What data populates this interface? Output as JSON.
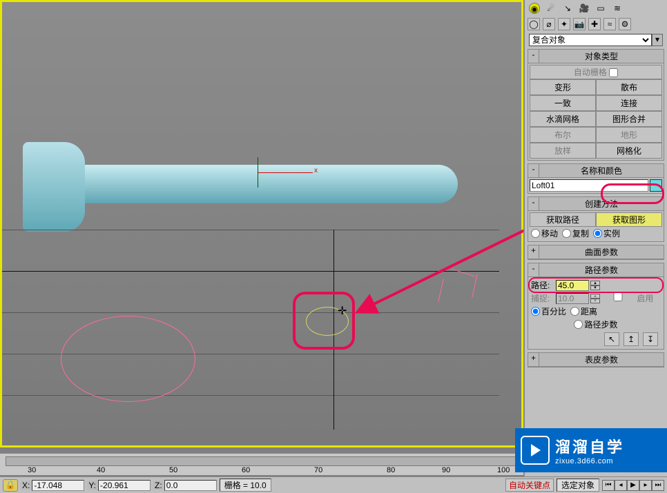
{
  "viewport": {
    "gizmo_x": "x"
  },
  "panel": {
    "dropdown": "复合对象",
    "rollouts": {
      "object_type": {
        "title": "对象类型",
        "auto_grid": "自动栅格",
        "buttons": [
          "变形",
          "散布",
          "一致",
          "连接",
          "水滴网格",
          "图形合并",
          "布尔",
          "地形",
          "放样",
          "网格化"
        ]
      },
      "name_color": {
        "title": "名称和颜色",
        "name": "Loft01"
      },
      "creation": {
        "title": "创建方法",
        "get_path": "获取路径",
        "get_shape": "获取图形",
        "opts": [
          "移动",
          "复制",
          "实例"
        ]
      },
      "surface": {
        "title": "曲面参数"
      },
      "path": {
        "title": "路径参数",
        "path_lbl": "路径:",
        "path_val": "45.0",
        "snap_lbl": "捕捉:",
        "snap_val": "10.0",
        "enable": "启用",
        "percent": "百分比",
        "distance": "距离",
        "steps": "路径步数"
      },
      "skin": {
        "title": "表皮参数"
      }
    }
  },
  "ruler": {
    "ticks": [
      "30",
      "40",
      "50",
      "60",
      "70",
      "80",
      "90",
      "100"
    ]
  },
  "status": {
    "x_lbl": "X:",
    "x": "-17.048",
    "y_lbl": "Y:",
    "y": "-20.961",
    "z_lbl": "Z:",
    "z": "0.0",
    "grid": "栅格 = 10.0",
    "autokey": "自动关键点",
    "selset": "选定对象"
  },
  "watermark": {
    "cn": "溜溜自学",
    "url": "zixue.3d66.com"
  }
}
